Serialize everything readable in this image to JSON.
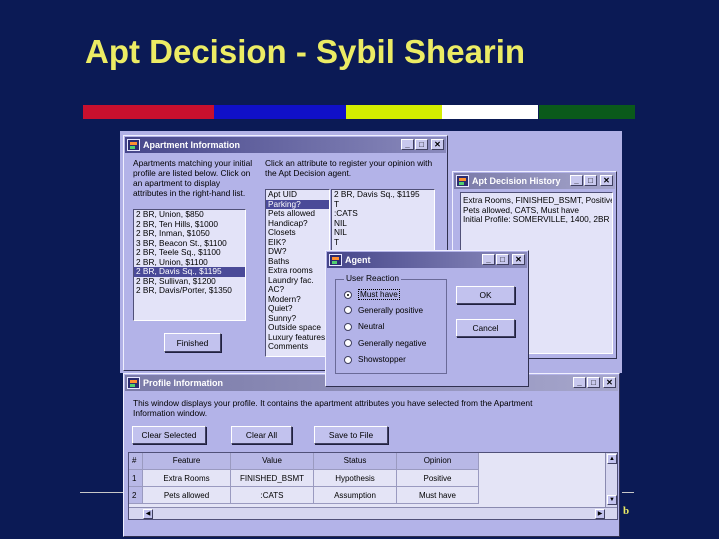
{
  "slide": {
    "title": "Apt Decision - Sybil Shearin",
    "stripe_colors": [
      "#c8102e",
      "#1010c8",
      "#d4ee00",
      "#ffffff",
      "#0a5a1a"
    ],
    "corner_letter": "b"
  },
  "apartment_info": {
    "title": "Apartment Information",
    "left_instructions": "Apartments matching your initial profile are listed below. Click on an apartment to display attributes in the right-hand list.",
    "right_instructions": "Click an attribute to register your opinion with the Apt Decision agent.",
    "apartments": [
      "2 BR, Union, $850",
      "2 BR, Ten Hills, $1000",
      "2 BR, Inman, $1050",
      "3 BR, Beacon St., $1100",
      "2 BR, Teele Sq., $1100",
      "2 BR, Union, $1100",
      "2 BR, Davis Sq., $1195",
      "2 BR, Sullivan, $1200",
      "2 BR, Davis/Porter, $1350"
    ],
    "selected_apartment_index": 6,
    "attributes": [
      "Apt UID",
      "Parking?",
      "Pets allowed",
      "Handicap?",
      "Closets",
      "EIK?",
      "DW?",
      "Baths",
      "Extra rooms",
      "Laundry fac.",
      "AC?",
      "Modern?",
      "Quiet?",
      "Sunny?",
      "Outside space",
      "Luxury features",
      "Comments"
    ],
    "selected_attribute_index": 1,
    "values": [
      "2 BR, Davis Sq., $1195",
      "T",
      ":CATS",
      "NIL",
      "NIL",
      "T"
    ],
    "finished_label": "Finished"
  },
  "history": {
    "title": "Apt Decision History",
    "entries": [
      "Extra Rooms, FINISHED_BSMT, Positive",
      "Pets allowed, CATS, Must have",
      "Initial Profile: SOMERVILLE, 1400, 2BR"
    ]
  },
  "agent": {
    "title": "Agent",
    "group_label": "User Reaction",
    "options": [
      "Must have",
      "Generally positive",
      "Neutral",
      "Generally negative",
      "Showstopper"
    ],
    "selected_option_index": 0,
    "ok_label": "OK",
    "cancel_label": "Cancel"
  },
  "profile": {
    "title": "Profile Information",
    "description": "This window displays your profile.  It contains the apartment attributes you have selected from the Apartment Information window.",
    "buttons": {
      "clear_selected": "Clear Selected",
      "clear_all": "Clear All",
      "save_to_file": "Save to File"
    },
    "columns": [
      "#",
      "Feature",
      "Value",
      "Status",
      "Opinion"
    ],
    "rows": [
      {
        "num": "1",
        "feature": "Extra Rooms",
        "value": "FINISHED_BSMT",
        "status": "Hypothesis",
        "opinion": "Positive"
      },
      {
        "num": "2",
        "feature": "Pets allowed",
        "value": ":CATS",
        "status": "Assumption",
        "opinion": "Must have"
      }
    ]
  }
}
